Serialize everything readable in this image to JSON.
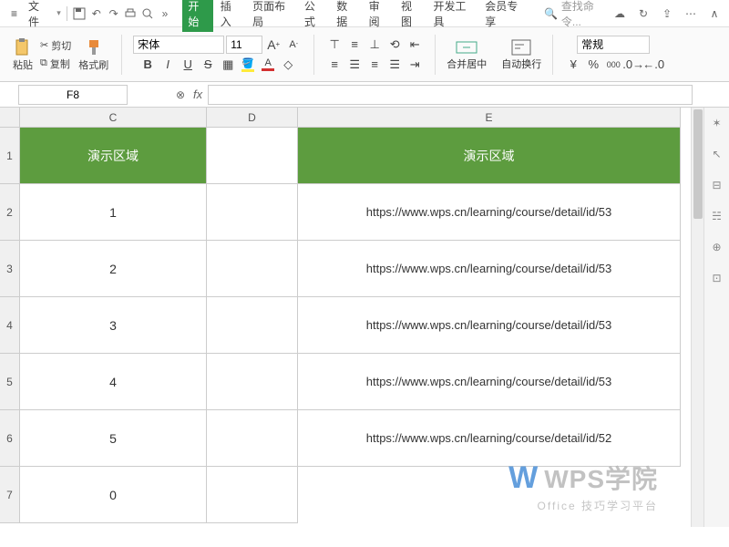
{
  "menubar": {
    "file": "文件"
  },
  "tabs": {
    "start": "开始",
    "insert": "插入",
    "layout": "页面布局",
    "formula": "公式",
    "data": "数据",
    "review": "审阅",
    "view": "视图",
    "dev": "开发工具",
    "member": "会员专享"
  },
  "search": {
    "placeholder": "查找命令..."
  },
  "ribbon": {
    "paste": "粘贴",
    "cut": "剪切",
    "copy": "复制",
    "format_painter": "格式刷",
    "font": "宋体",
    "size": "11",
    "merge": "合并居中",
    "wrap": "自动换行",
    "numfmt": "常规"
  },
  "formula_bar": {
    "cell_ref": "F8",
    "value": ""
  },
  "columns": {
    "c": "C",
    "d": "D",
    "e": "E"
  },
  "rows": [
    "1",
    "2",
    "3",
    "4",
    "5",
    "6",
    "7"
  ],
  "sheet": {
    "c_header": "演示区域",
    "e_header": "演示区域",
    "c_vals": [
      "1",
      "2",
      "3",
      "4",
      "5",
      "0"
    ],
    "e_vals": [
      "https://www.wps.cn/learning/course/detail/id/53",
      "https://www.wps.cn/learning/course/detail/id/53",
      "https://www.wps.cn/learning/course/detail/id/53",
      "https://www.wps.cn/learning/course/detail/id/53",
      "https://www.wps.cn/learning/course/detail/id/52"
    ]
  },
  "watermark": {
    "brand": "WPS学院",
    "sub": "Office 技巧学习平台"
  },
  "symbols": {
    "percent": "%",
    "yen": "¥",
    "zero": "000",
    "b": "B",
    "i": "I",
    "u": "U",
    "s": "S",
    "a": "A",
    "sup": "A",
    "sub": "A"
  }
}
